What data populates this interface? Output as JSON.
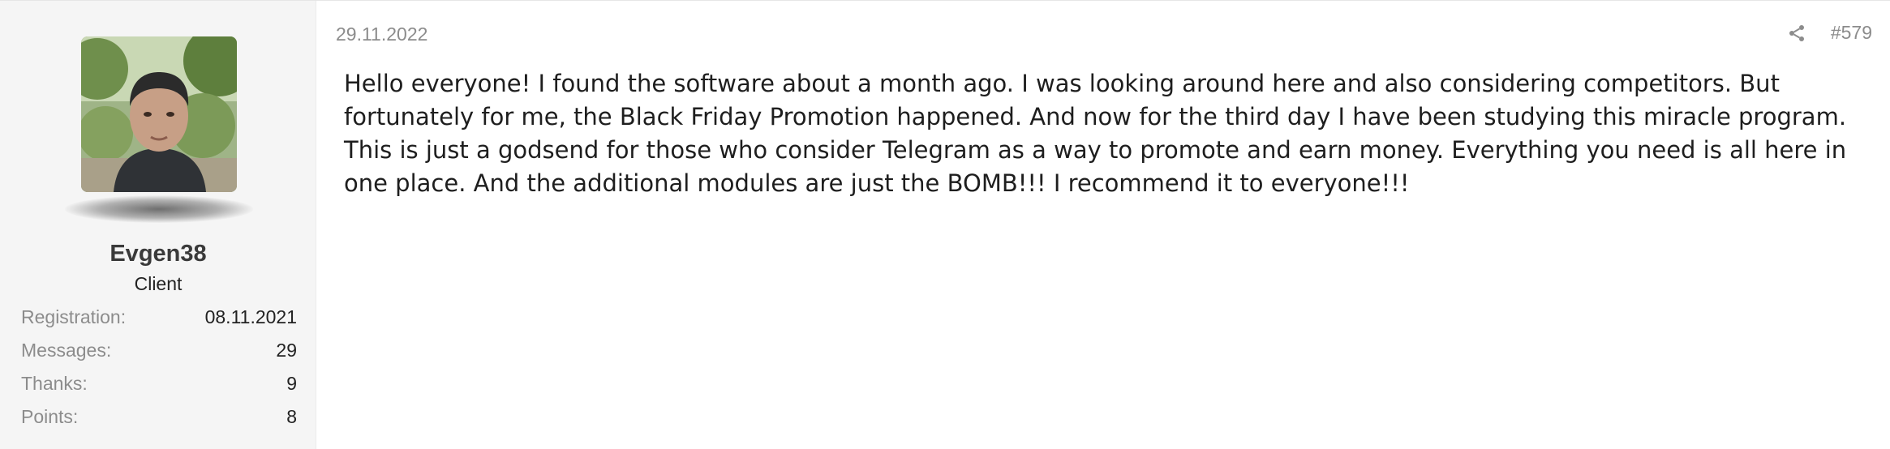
{
  "user": {
    "avatar_icon": "user-avatar-photo",
    "name": "Evgen38",
    "title": "Client",
    "stats": [
      {
        "label": "Registration:",
        "value": "08.11.2021"
      },
      {
        "label": "Messages:",
        "value": "29"
      },
      {
        "label": "Thanks:",
        "value": "9"
      },
      {
        "label": "Points:",
        "value": "8"
      }
    ]
  },
  "post": {
    "date": "29.11.2022",
    "share_icon": "share-icon",
    "number": "#579",
    "text": "Hello everyone! I found the software about a month ago. I was looking around here and also considering competitors. But fortunately for me, the Black Friday Promotion happened. And now for the third day I have been studying this miracle program. This is just a godsend for those who consider Telegram as a way to promote and earn money. Everything you need is all here in one place. And the additional modules are just the BOMB!!! I recommend it to everyone!!!"
  },
  "colors": {
    "panel_background": "#f5f5f5",
    "muted_text": "#8c8c8c",
    "body_text": "#1e1e1e"
  }
}
